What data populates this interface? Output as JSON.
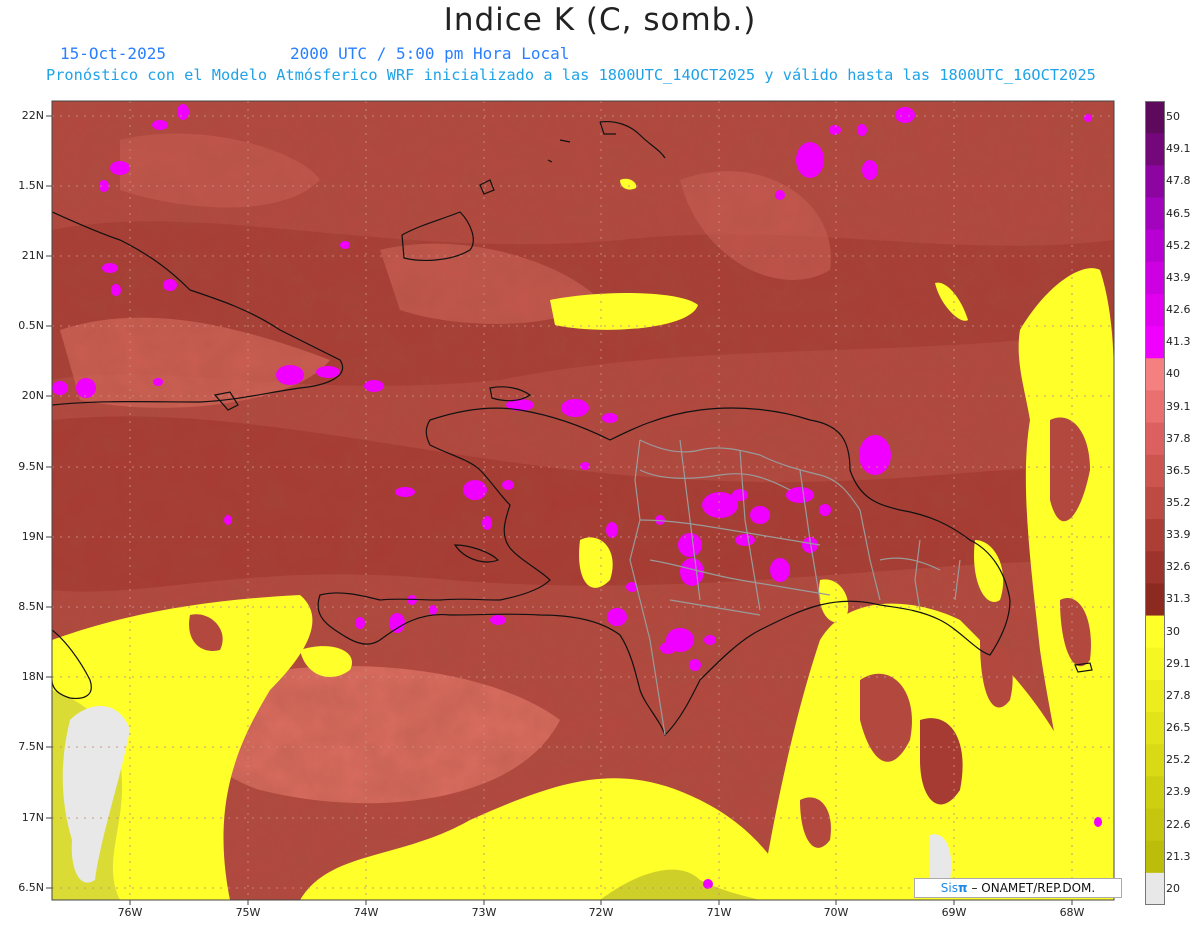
{
  "title": "Indice K (C, somb.)",
  "header": {
    "date": "15-Oct-2025",
    "time": "2000 UTC / 5:00 pm Hora Local",
    "description": "Pronóstico con el Modelo Atmósferico WRF inicializado a las 1800UTC_14OCT2025 y válido hasta las  1800UTC_16OCT2025"
  },
  "map": {
    "lat_labels": [
      "22N",
      "1.5N",
      "21N",
      "0.5N",
      "20N",
      "9.5N",
      "19N",
      "8.5N",
      "18N",
      "7.5N",
      "17N",
      "6.5N"
    ],
    "lon_labels": [
      "76W",
      "75W",
      "74W",
      "73W",
      "72W",
      "71W",
      "70W",
      "69W",
      "68W"
    ]
  },
  "colorbar": {
    "labels": [
      "50",
      "49.1",
      "47.8",
      "46.5",
      "45.2",
      "43.9",
      "42.6",
      "41.3",
      "40",
      "39.1",
      "37.8",
      "36.5",
      "35.2",
      "33.9",
      "32.6",
      "31.3",
      "30",
      "29.1",
      "27.8",
      "26.5",
      "25.2",
      "23.9",
      "22.6",
      "21.3",
      "20"
    ],
    "colors": [
      "#5d0a5d",
      "#74077a",
      "#8c05a0",
      "#a203bd",
      "#b800d4",
      "#cc00e0",
      "#e000ef",
      "#f000ff",
      "#f58080",
      "#ea7070",
      "#dc6060",
      "#cd5550",
      "#be4a44",
      "#ac3e36",
      "#9c342c",
      "#8c2a20",
      "#ffff2a",
      "#f6f623",
      "#ecec1e",
      "#e3e31a",
      "#d9d916",
      "#cfcf12",
      "#c6c60e",
      "#bcbc0a",
      "#e8e8e8"
    ]
  },
  "credit": {
    "logo": "Sis",
    "pi": "π",
    "text": "– ONAMET/REP.DOM."
  }
}
